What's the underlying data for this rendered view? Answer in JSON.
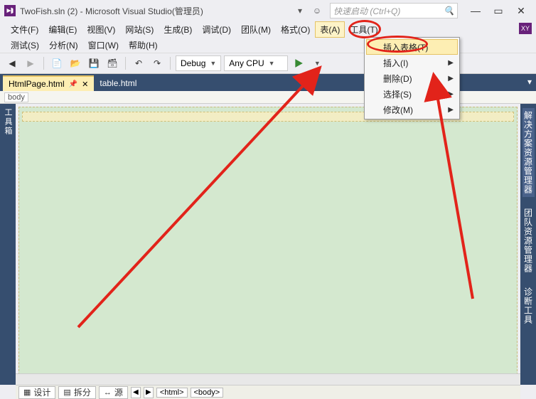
{
  "title": "TwoFish.sln (2) - Microsoft Visual Studio(管理员)",
  "quick_launch_placeholder": "快速启动 (Ctrl+Q)",
  "menubar1": {
    "file": "文件(F)",
    "edit": "编辑(E)",
    "view": "视图(V)",
    "site": "网站(S)",
    "build": "生成(B)",
    "debug": "调试(D)",
    "team": "团队(M)",
    "format": "格式(O)",
    "table": "表(A)",
    "tools": "工具(T)"
  },
  "menubar2": {
    "test": "测试(S)",
    "analyze": "分析(N)",
    "window": "窗口(W)",
    "help": "帮助(H)"
  },
  "toolbar": {
    "config": "Debug",
    "platform": "Any CPU"
  },
  "context_menu": {
    "insert_table": "插入表格(T)",
    "insert": "插入(I)",
    "delete": "删除(D)",
    "select": "选择(S)",
    "modify": "修改(M)"
  },
  "tabs": {
    "active": "HtmlPage.html",
    "inactive": "table.html"
  },
  "breadcrumb": {
    "seg1": "body"
  },
  "left_tool": "工具箱",
  "right_tools": {
    "solution": "解决方案资源管理器",
    "team": "团队资源管理器",
    "diagnostic": "诊断工具"
  },
  "viewbar": {
    "design": "设计",
    "split": "拆分",
    "source": "源",
    "html": "<html>",
    "body": "<body>"
  },
  "xy": "XY"
}
